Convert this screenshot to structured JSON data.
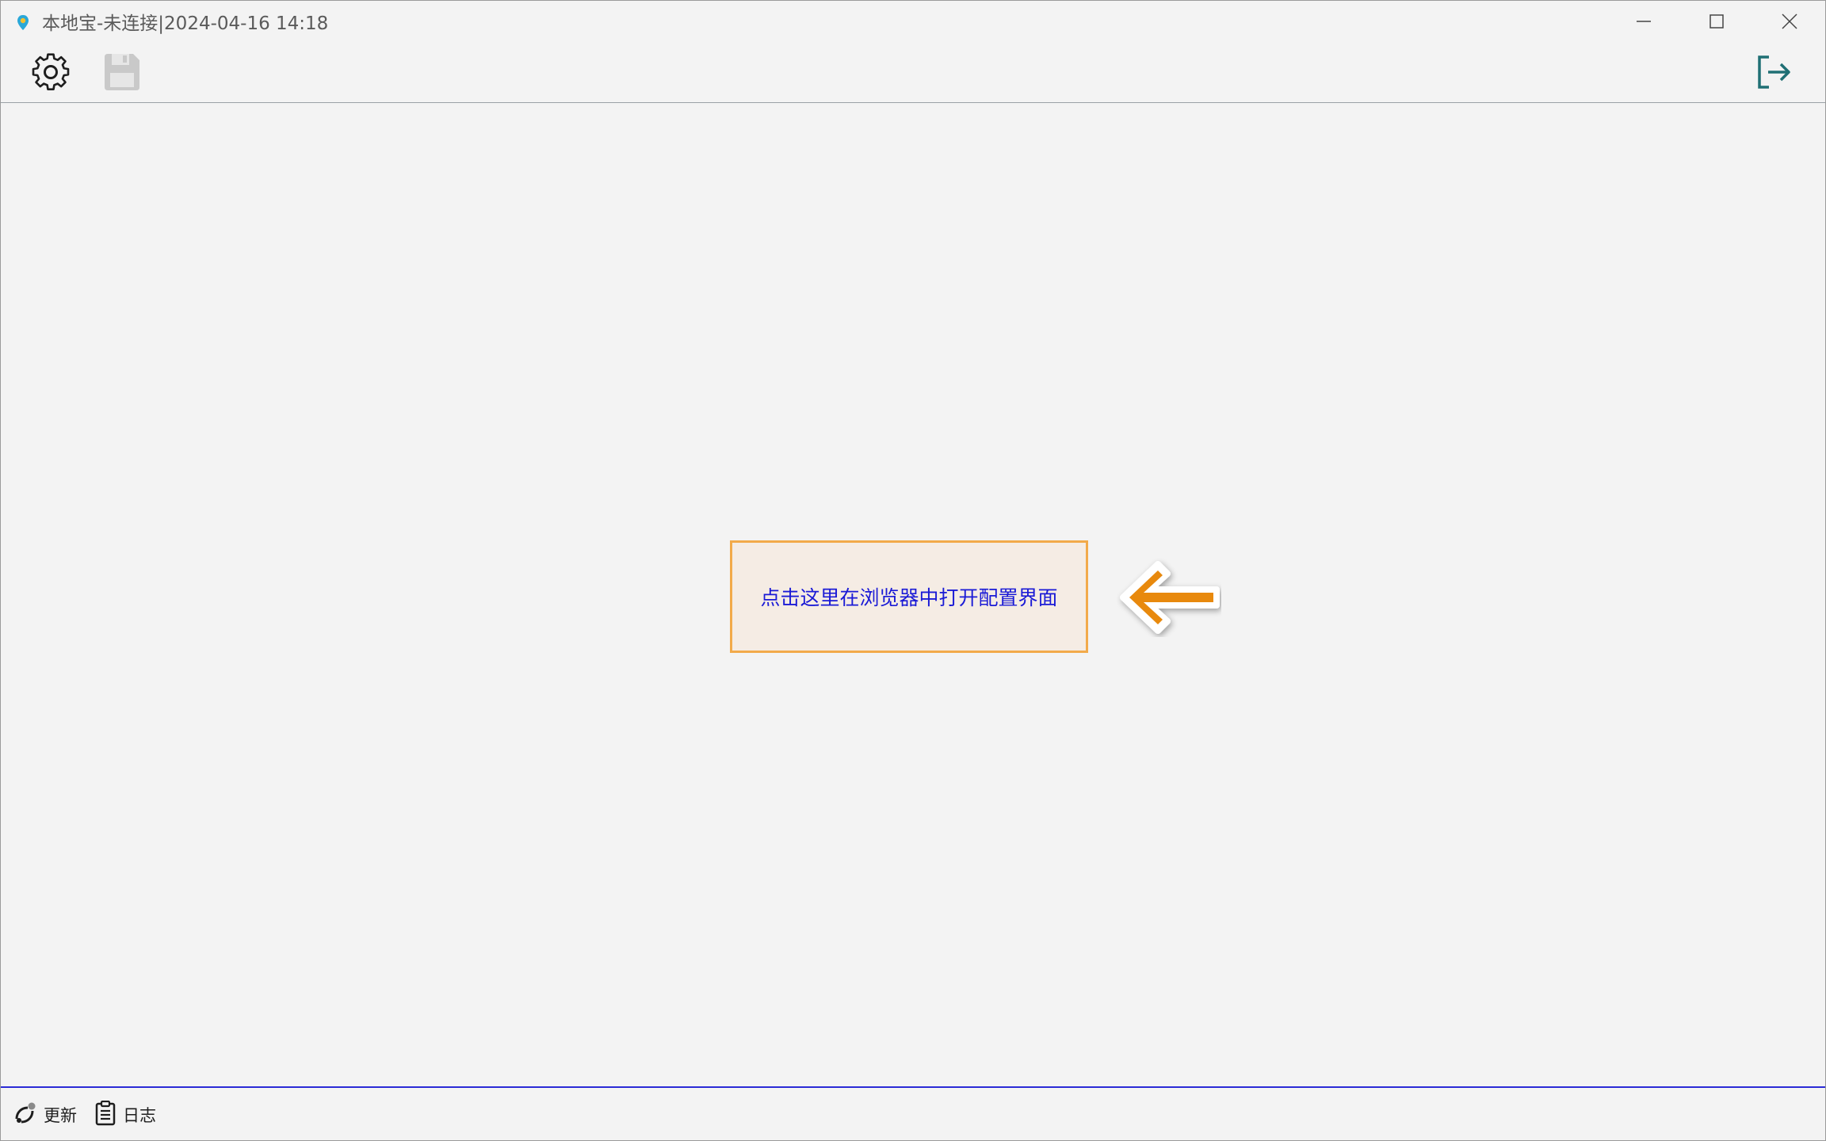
{
  "window": {
    "title": "本地宝-未连接|2024-04-16 14:18",
    "app_icon": "location-pin-icon"
  },
  "window_controls": {
    "minimize_icon": "minimize-icon",
    "maximize_icon": "maximize-icon",
    "close_icon": "close-icon"
  },
  "toolbar": {
    "settings_icon": "gear-icon",
    "save_icon": "floppy-disk-icon",
    "exit_icon": "logout-icon"
  },
  "main": {
    "open_config_label": "点击这里在浏览器中打开配置界面",
    "pointer_icon": "arrow-left-icon"
  },
  "statusbar": {
    "update_label": "更新",
    "log_label": "日志"
  },
  "colors": {
    "background": "#f3f3f3",
    "link_text": "#1a1ad6",
    "highlight_border": "#f2aa4a",
    "highlight_fill": "#f5ece4",
    "arrow": "#e8890c",
    "exit_icon": "#1f6f74",
    "status_border": "#2b2bd6"
  }
}
